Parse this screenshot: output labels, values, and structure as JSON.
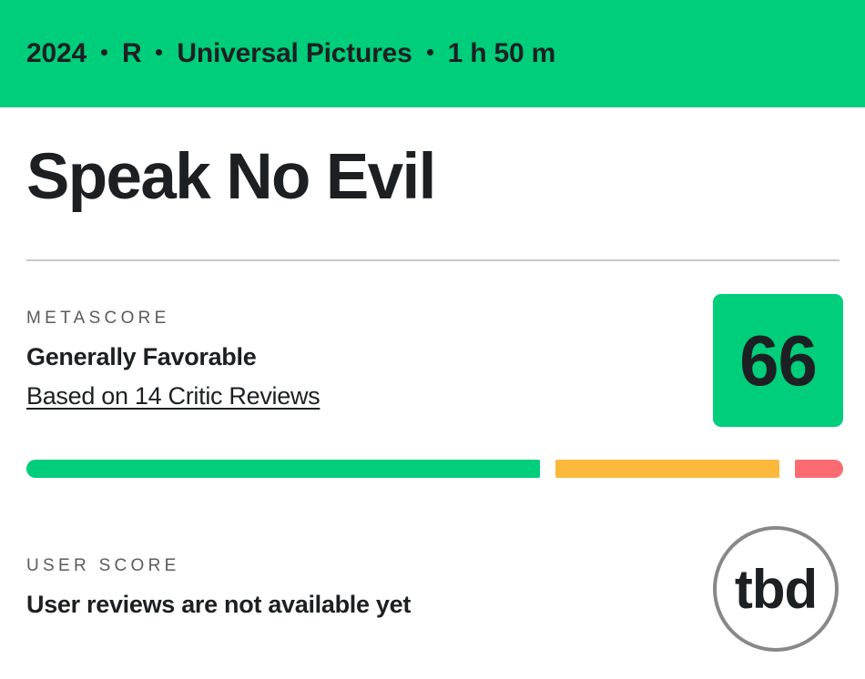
{
  "header": {
    "items": [
      {
        "label": "2024"
      },
      {
        "label": "R"
      },
      {
        "label": "Universal Pictures"
      },
      {
        "label": "1 h 50 m"
      }
    ],
    "background_color": "#00ce7a",
    "text_color": "#1d2022"
  },
  "title": "Speak No Evil",
  "metascore": {
    "label": "METASCORE",
    "description": "Generally Favorable",
    "reviews_link": "Based on 14 Critic Reviews",
    "value": "66",
    "box_color": "#00ce7a"
  },
  "score_distribution": {
    "segments": [
      {
        "name": "positive",
        "color": "#00ce7a"
      },
      {
        "name": "mixed",
        "color": "#fbb93c"
      },
      {
        "name": "negative",
        "color": "#fc6a72"
      }
    ]
  },
  "user_score": {
    "label": "USER SCORE",
    "description": "User reviews are not available yet",
    "value": "tbd",
    "border_color": "#888888"
  }
}
